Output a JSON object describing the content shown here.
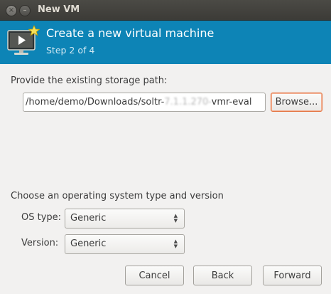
{
  "window": {
    "title": "New VM",
    "close_glyph": "×",
    "minimize_glyph": "–"
  },
  "header": {
    "icon": "vm-monitor-icon",
    "title": "Create a new virtual machine",
    "step": "Step 2 of 4"
  },
  "storage": {
    "label": "Provide the existing storage path:",
    "path_prefix": "/home/demo/Downloads/soltr-",
    "path_redacted": "7.1.1.270-",
    "path_suffix": "vmr-eval",
    "browse_label": "Browse..."
  },
  "os": {
    "heading": "Choose an operating system type and version",
    "type_label": "OS type:",
    "type_value": "Generic",
    "version_label": "Version:",
    "version_value": "Generic"
  },
  "buttons": {
    "cancel": "Cancel",
    "back": "Back",
    "forward": "Forward"
  },
  "colors": {
    "header_bg": "#0d84b6",
    "focus_accent": "#e5703b"
  }
}
